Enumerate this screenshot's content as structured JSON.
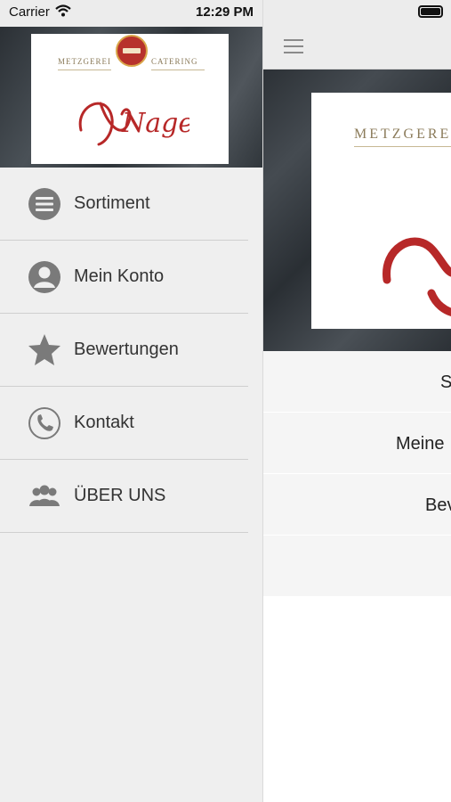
{
  "status_bar": {
    "carrier": "Carrier",
    "time": "12:29 PM"
  },
  "drawer": {
    "logo": {
      "left_text": "METZGEREI",
      "right_text": "CATERING",
      "script_text": "Nagel!"
    },
    "menu": [
      {
        "label": "Sortiment",
        "icon": "list-circle-icon"
      },
      {
        "label": "Mein Konto",
        "icon": "user-circle-icon"
      },
      {
        "label": "Bewertungen",
        "icon": "star-icon"
      },
      {
        "label": "Kontakt",
        "icon": "phone-icon"
      },
      {
        "label": "ÜBER UNS",
        "icon": "group-icon"
      }
    ]
  },
  "main": {
    "logo_text": "METZGERE",
    "list": [
      "S",
      "Meine",
      "Bev"
    ]
  },
  "colors": {
    "accent_red": "#b7322c",
    "icon_gray": "#7a7a7a",
    "drawer_bg": "#efefef"
  }
}
